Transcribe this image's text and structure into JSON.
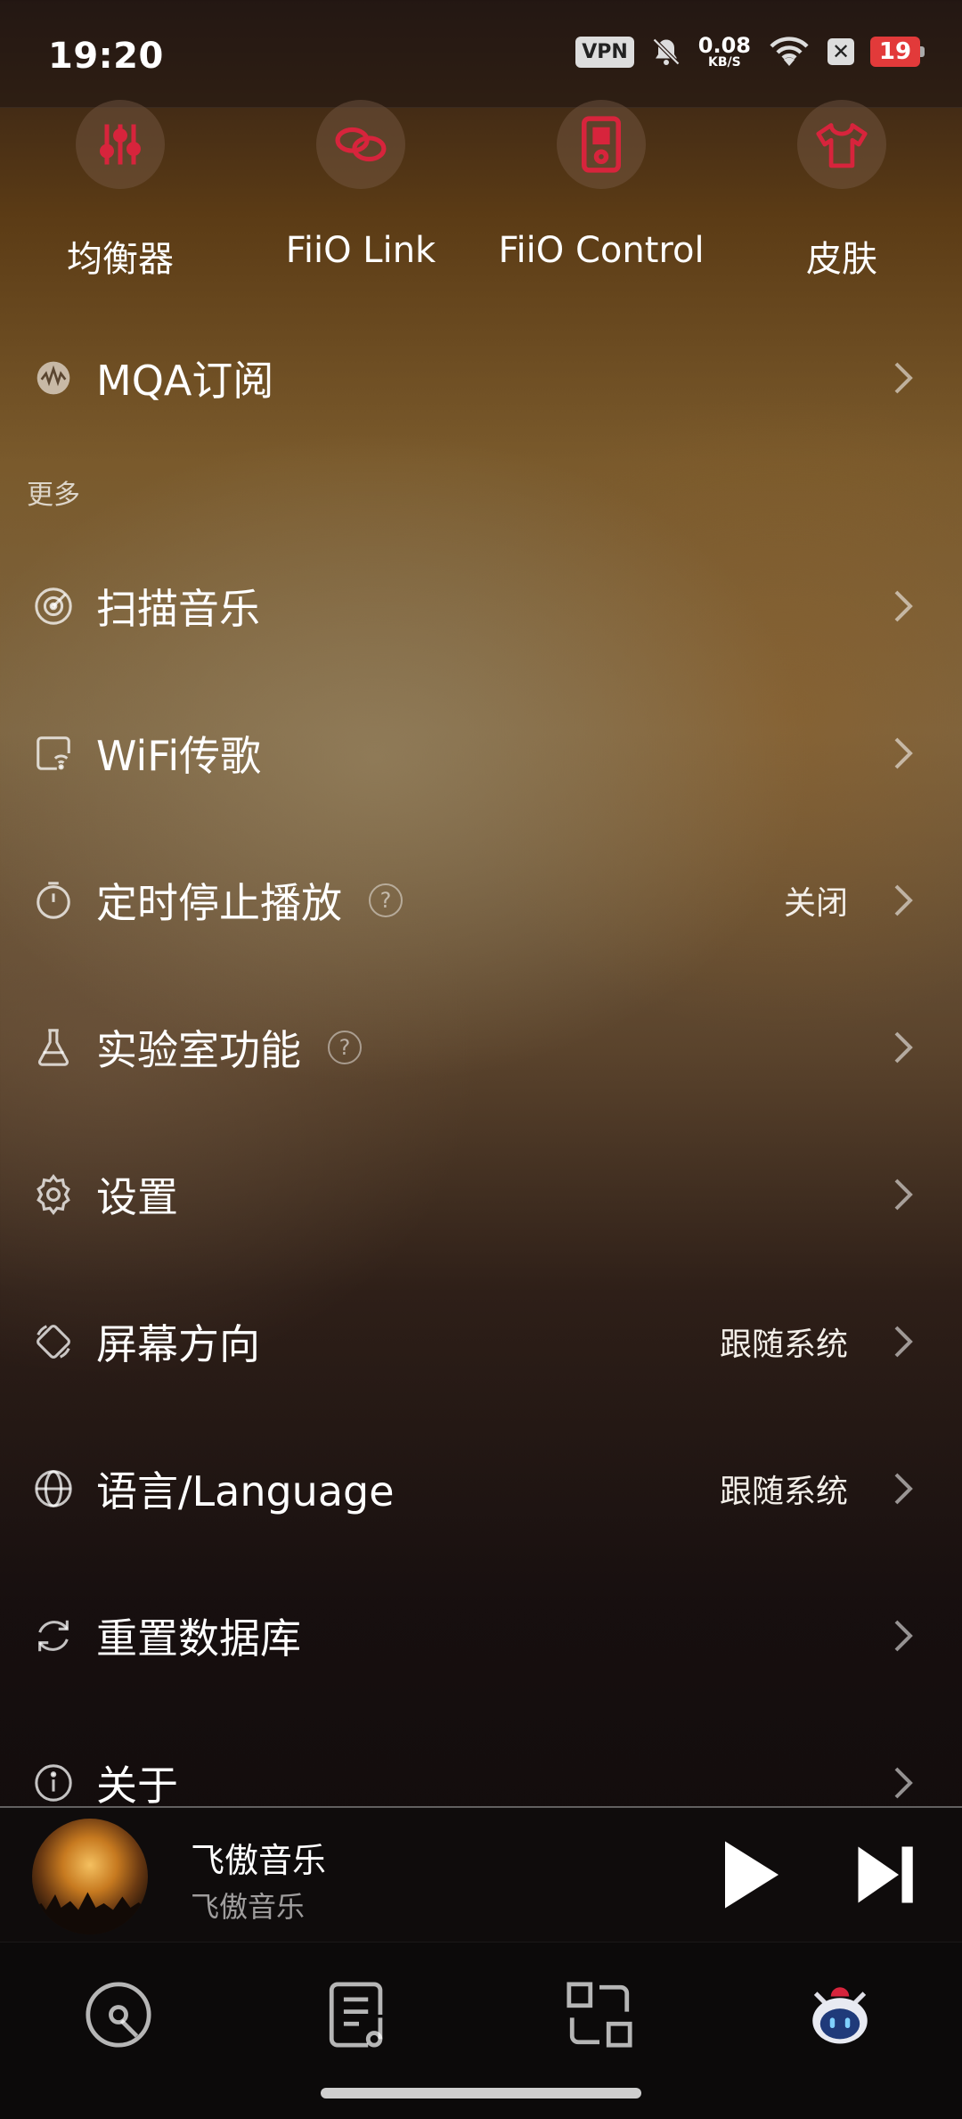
{
  "status": {
    "time": "19:20",
    "vpn": "VPN",
    "speed": "0.08",
    "speed_unit": "KB/S",
    "battery": "19"
  },
  "shortcuts": [
    {
      "label": "均衡器",
      "icon": "equalizer-icon"
    },
    {
      "label": "FiiO Link",
      "icon": "link-icon"
    },
    {
      "label": "FiiO Control",
      "icon": "player-device-icon"
    },
    {
      "label": "皮肤",
      "icon": "tshirt-icon"
    }
  ],
  "mqa": {
    "label": "MQA订阅"
  },
  "section_more": "更多",
  "menu": [
    {
      "label": "扫描音乐",
      "icon": "scan-icon"
    },
    {
      "label": "WiFi传歌",
      "icon": "wifi-transfer-icon"
    },
    {
      "label": "定时停止播放",
      "icon": "timer-icon",
      "value": "关闭",
      "help": "?"
    },
    {
      "label": "实验室功能",
      "icon": "flask-icon",
      "help": "?"
    },
    {
      "label": "设置",
      "icon": "gear-icon"
    },
    {
      "label": "屏幕方向",
      "icon": "screen-rotation-icon",
      "value": "跟随系统"
    },
    {
      "label": "语言/Language",
      "icon": "globe-icon",
      "value": "跟随系统"
    },
    {
      "label": "重置数据库",
      "icon": "refresh-icon"
    },
    {
      "label": "关于",
      "icon": "info-icon"
    }
  ],
  "player": {
    "title": "飞傲音乐",
    "artist": "飞傲音乐"
  },
  "nav": [
    "disc-icon",
    "playlist-icon",
    "switch-icon",
    "robot-mascot-icon"
  ],
  "colors": {
    "accent": "#d7243c",
    "background_top": "#5b3b15",
    "player_bg": "#0f0c0c"
  }
}
